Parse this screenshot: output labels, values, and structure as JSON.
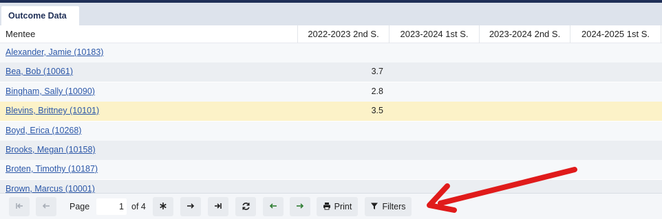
{
  "tab": {
    "label": "Outcome Data"
  },
  "table": {
    "columns": [
      "Mentee",
      "2022-2023 2nd S.",
      "2023-2024 1st S.",
      "2023-2024 2nd S.",
      "2024-2025 1st S."
    ],
    "rows": [
      {
        "mentee": "Alexander, Jamie (10183)",
        "c1": "",
        "c2": "",
        "c3": "",
        "c4": ""
      },
      {
        "mentee": "Bea, Bob (10061)",
        "c1": "3.7",
        "c2": "",
        "c3": "",
        "c4": ""
      },
      {
        "mentee": "Bingham, Sally (10090)",
        "c1": "2.8",
        "c2": "",
        "c3": "",
        "c4": ""
      },
      {
        "mentee": "Blevins, Brittney (10101)",
        "c1": "3.5",
        "c2": "",
        "c3": "",
        "c4": ""
      },
      {
        "mentee": "Boyd, Erica (10268)",
        "c1": "",
        "c2": "",
        "c3": "",
        "c4": ""
      },
      {
        "mentee": "Brooks, Megan (10158)",
        "c1": "",
        "c2": "",
        "c3": "",
        "c4": ""
      },
      {
        "mentee": "Broten, Timothy (10187)",
        "c1": "",
        "c2": "",
        "c3": "",
        "c4": ""
      },
      {
        "mentee": "Brown, Marcus (10001)",
        "c1": "",
        "c2": "",
        "c3": "",
        "c4": ""
      }
    ]
  },
  "pager": {
    "page_label": "Page",
    "current_page": "1",
    "of_label": "of 4",
    "print_label": "Print",
    "filters_label": "Filters"
  },
  "colors": {
    "header_bar": "#1f2f57",
    "link": "#2b57a8",
    "selected_row": "#fcf2c8",
    "annotation_arrow": "#e01b1b"
  },
  "icons": [
    "first-page-icon",
    "previous-page-icon",
    "asterisk-icon",
    "next-page-icon",
    "last-page-icon",
    "refresh-icon",
    "green-left-arrow-icon",
    "green-right-arrow-icon",
    "printer-icon",
    "filter-icon"
  ]
}
